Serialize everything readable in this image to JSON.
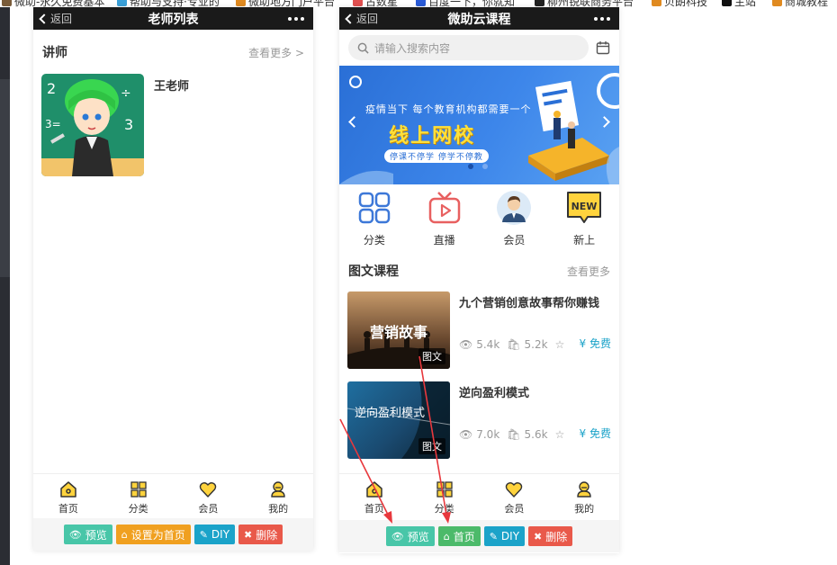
{
  "bookmarks": [
    {
      "label": "微助-永久免费基本",
      "color": "#7a5c3a"
    },
    {
      "label": "帮助与支持·专业的",
      "color": "#3aa0d8"
    },
    {
      "label": "微助地方门户平台",
      "color": "#e08a20"
    },
    {
      "label": "古数星",
      "color": "#e05050"
    },
    {
      "label": "百度一下，你就知",
      "color": "#2a5bd6"
    },
    {
      "label": "柳州锐联商务平台",
      "color": "#222222"
    },
    {
      "label": "贝朗科技",
      "color": "#e08a20"
    },
    {
      "label": "主站",
      "color": "#111111"
    },
    {
      "label": "商城教程",
      "color": "#e08a20"
    }
  ],
  "left_phone": {
    "back_label": "返回",
    "title": "老师列表",
    "section_title": "讲师",
    "more_label": "查看更多 >",
    "teacher_name": "王老师",
    "tabs": [
      {
        "label": "首页",
        "icon": "home-icon"
      },
      {
        "label": "分类",
        "icon": "grid-icon"
      },
      {
        "label": "会员",
        "icon": "heart-icon"
      },
      {
        "label": "我的",
        "icon": "user-icon"
      }
    ],
    "actions": {
      "preview": "预览",
      "set_home": "设置为首页",
      "diy": "DIY",
      "delete": "删除"
    }
  },
  "right_phone": {
    "back_label": "返回",
    "title": "微助云课程",
    "search_placeholder": "请输入搜索内容",
    "banner": {
      "line1": "疫情当下 每个教育机构都需要一个",
      "line2": "线上网校",
      "line3": "停课不停学  停学不停教"
    },
    "icons": [
      {
        "label": "分类",
        "icon": "category-grid-icon"
      },
      {
        "label": "直播",
        "icon": "tv-icon"
      },
      {
        "label": "会员",
        "icon": "member-avatar-icon"
      },
      {
        "label": "新上",
        "icon": "new-badge-icon"
      }
    ],
    "new_badge_text": "NEW",
    "section_title": "图文课程",
    "more_label": "查看更多",
    "courses": [
      {
        "title": "九个营销创意故事帮你赚钱",
        "views": "5.4k",
        "buys": "5.2k",
        "price": "¥ 免费",
        "tag": "图文",
        "thumb_text": "营销故事"
      },
      {
        "title": "逆向盈利模式",
        "views": "7.0k",
        "buys": "5.6k",
        "price": "¥ 免费",
        "tag": "图文",
        "thumb_text": "逆向盈利模式"
      }
    ],
    "tabs": [
      {
        "label": "首页",
        "icon": "home-icon"
      },
      {
        "label": "分类",
        "icon": "grid-icon"
      },
      {
        "label": "会员",
        "icon": "heart-icon"
      },
      {
        "label": "我的",
        "icon": "user-icon"
      }
    ],
    "actions": {
      "preview": "预览",
      "home": "首页",
      "diy": "DIY",
      "delete": "删除"
    }
  },
  "colors": {
    "preview": "#48c6a8",
    "set_home": "#f0a020",
    "home": "#4cba6a",
    "diy": "#1ba3c9",
    "delete": "#e9594a",
    "price": "#1ba3c9",
    "annotation_arrow": "#e8383d"
  }
}
